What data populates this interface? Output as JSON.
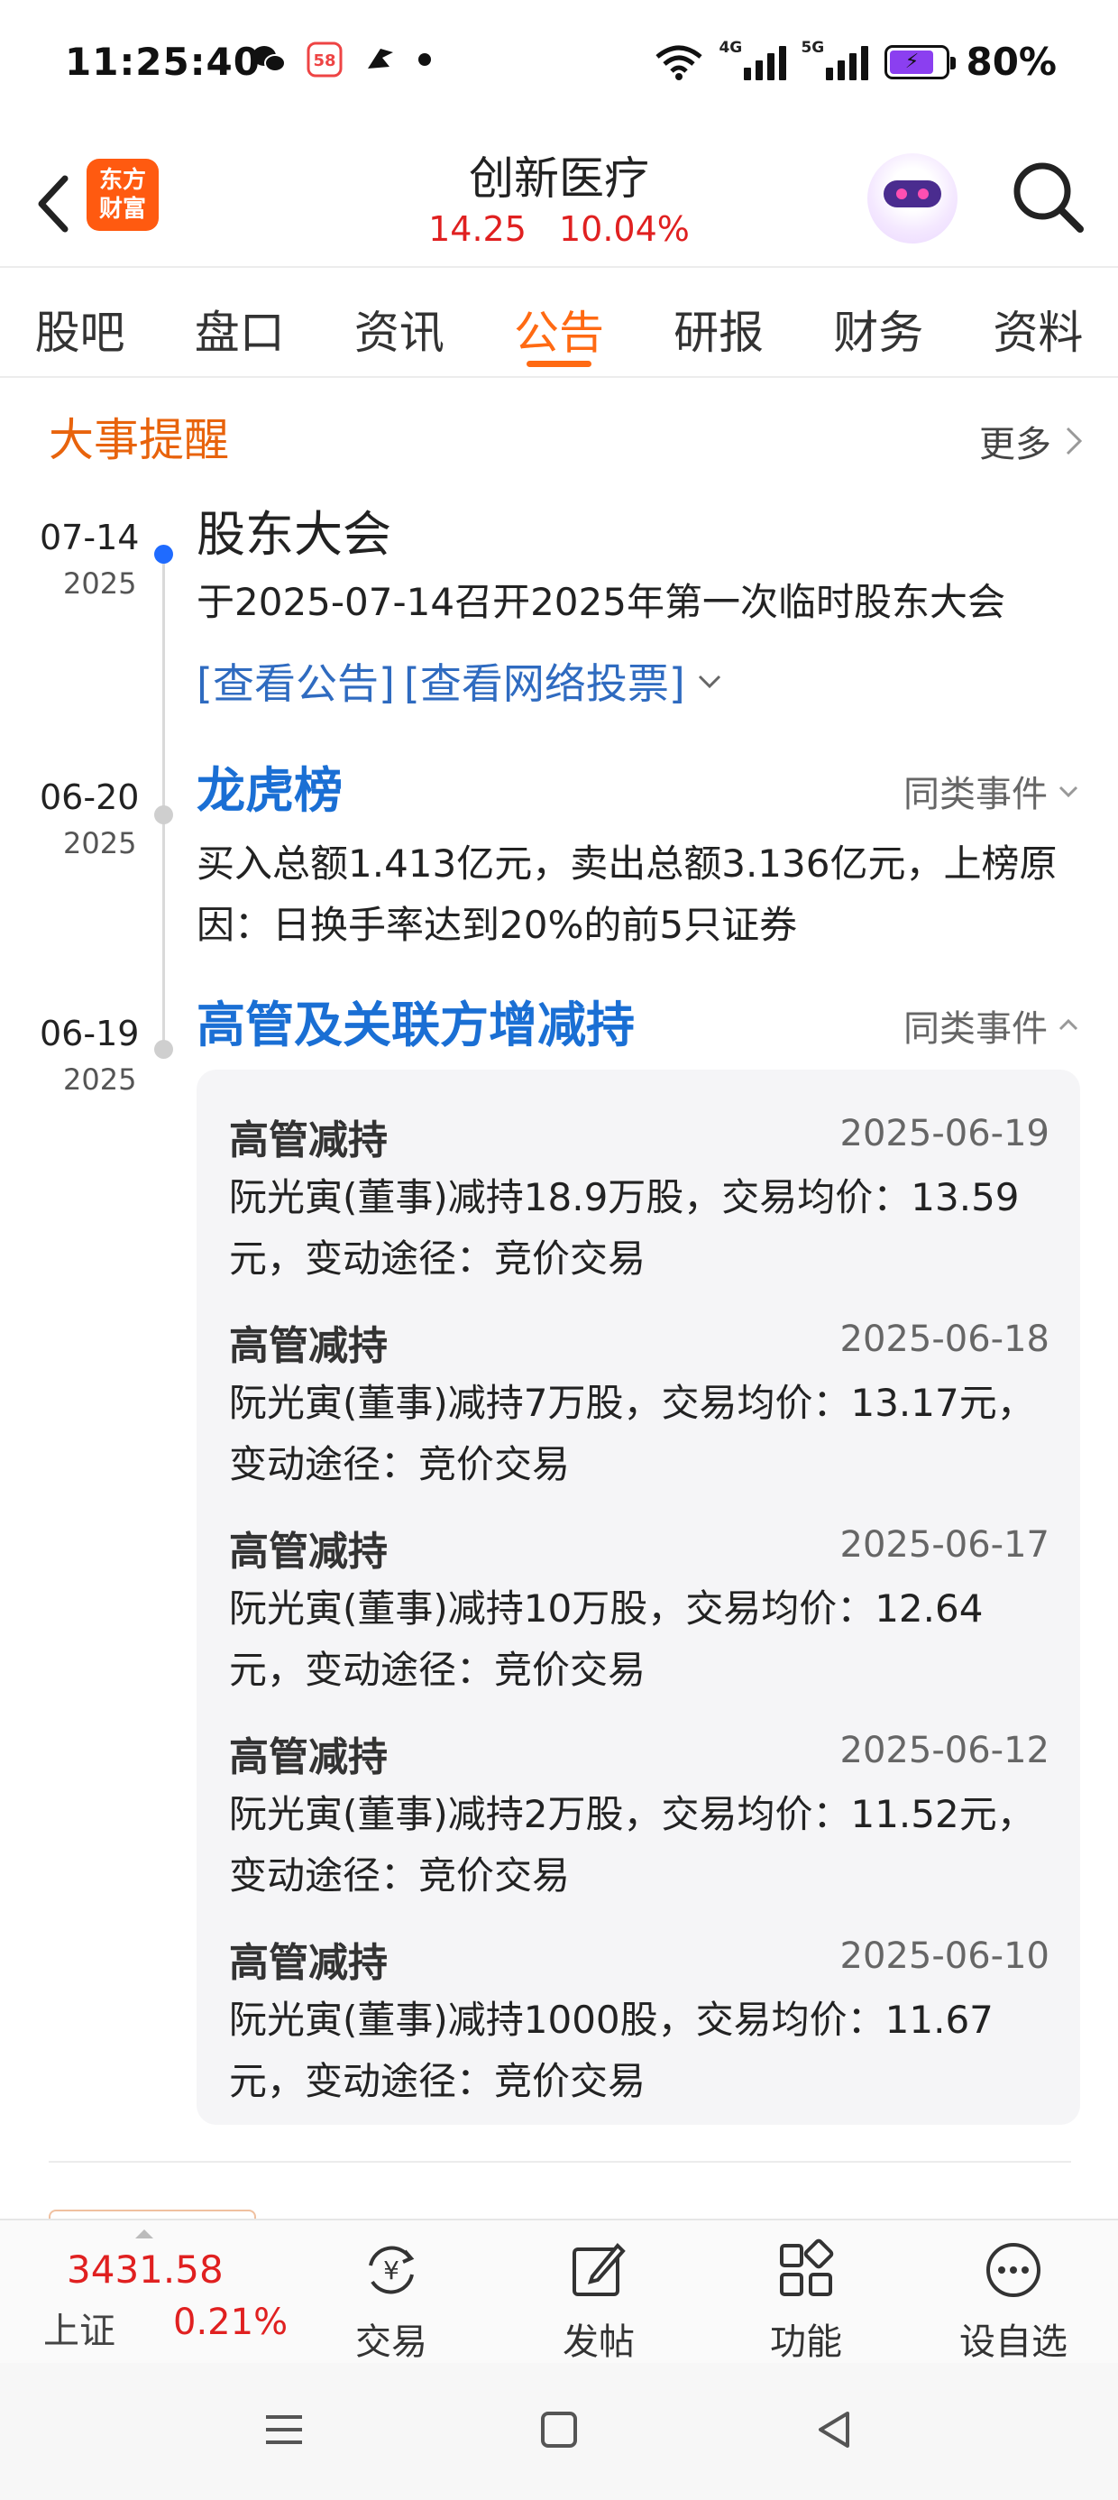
{
  "status_bar": {
    "time": "11:25:40",
    "battery_pct": "80%",
    "battery_level": 0.8,
    "app_icons": [
      "wechat-icon",
      "58-app-icon",
      "bird-app-icon",
      "dot-icon"
    ],
    "net_labels": [
      "4G",
      "5G"
    ]
  },
  "header": {
    "stock_name": "创新医疗",
    "price": "14.25",
    "change_pct": "10.04%",
    "logo_text_line1": "东方",
    "logo_text_line2": "财富"
  },
  "tabs": [
    "股吧",
    "盘口",
    "资讯",
    "公告",
    "研报",
    "财务",
    "资料"
  ],
  "active_tab": "公告",
  "section": {
    "title": "大事提醒",
    "more": "更多"
  },
  "events": [
    {
      "date_md": "07-14",
      "date_year": "2025",
      "title": "股东大会",
      "text": "于2025-07-14召开2025年第一次临时股东大会",
      "links": [
        "[查看公告]",
        "[查看网络投票]"
      ]
    },
    {
      "date_md": "06-20",
      "date_year": "2025",
      "title": "龙虎榜",
      "similar": "同类事件",
      "text": "买入总额1.413亿元，卖出总额3.136亿元，上榜原因：日换手率达到20%的前5只证券"
    },
    {
      "date_md": "06-19",
      "date_year": "2025",
      "title": "高管及关联方增减持",
      "similar": "同类事件",
      "details": [
        {
          "title": "高管减持",
          "date": "2025-06-19",
          "desc": "阮光寅(董事)减持18.9万股，交易均价：13.59元，变动途径：竞价交易"
        },
        {
          "title": "高管减持",
          "date": "2025-06-18",
          "desc": "阮光寅(董事)减持7万股，交易均价：13.17元，变动途径：竞价交易"
        },
        {
          "title": "高管减持",
          "date": "2025-06-17",
          "desc": "阮光寅(董事)减持10万股，交易均价：12.64元，变动途径：竞价交易"
        },
        {
          "title": "高管减持",
          "date": "2025-06-12",
          "desc": "阮光寅(董事)减持2万股，交易均价：11.52元，变动途径：竞价交易"
        },
        {
          "title": "高管减持",
          "date": "2025-06-10",
          "desc": "阮光寅(董事)减持1000股，交易均价：11.67元，变动途径：竞价交易"
        }
      ]
    }
  ],
  "bottom_bar": {
    "index_value": "3431.58",
    "index_name": "上证",
    "index_pct": "0.21%",
    "items": [
      "交易",
      "发帖",
      "功能",
      "设自选"
    ]
  },
  "colors": {
    "accent_orange": "#ff6a13",
    "up_red": "#e02020",
    "link_blue": "#1a6fd4"
  }
}
